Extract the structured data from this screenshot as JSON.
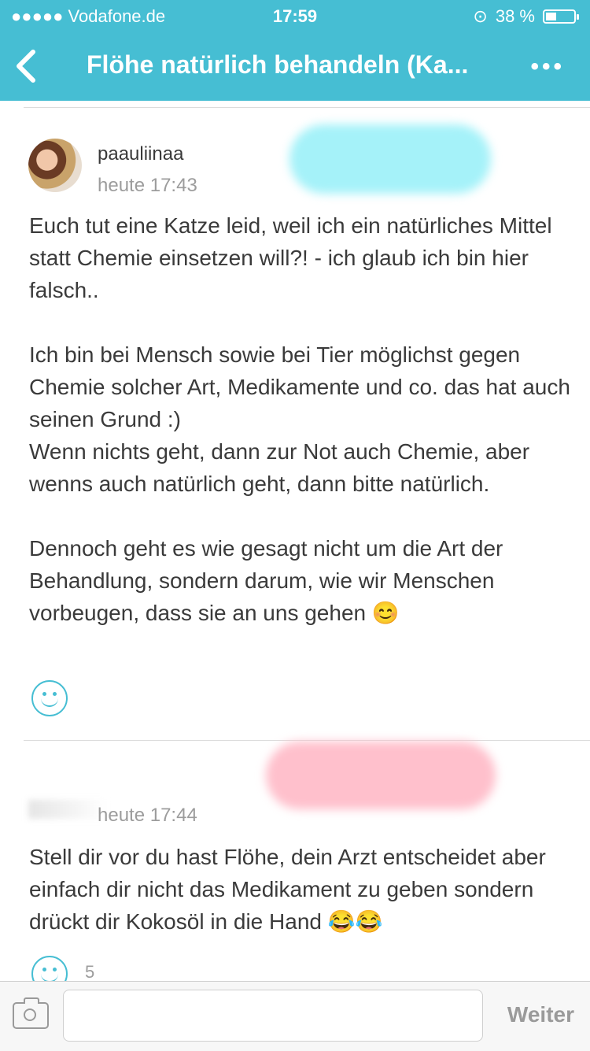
{
  "status_bar": {
    "carrier": "●●●●● Vodafone.de",
    "time": "17:59",
    "battery": "38 %",
    "battery_level": 0.38
  },
  "nav": {
    "title": "Flöhe natürlich behandeln (Ka...",
    "more_label": "•••"
  },
  "posts": [
    {
      "username": "paauliinaa",
      "time": "heute 17:43",
      "paragraphs": [
        "Euch tut eine Katze leid, weil ich ein natürliches Mittel statt Chemie einsetzen will?! - ich glaub ich bin hier falsch..",
        "Ich bin bei Mensch sowie bei Tier möglichst gegen Chemie solcher Art, Medikamente und co. das hat auch seinen Grund :)\nWenn nichts geht, dann zur Not auch Chemie, aber wenns auch natürlich geht, dann bitte natürlich.",
        "Dennoch geht es wie gesagt nicht um die Art der Behandlung, sondern darum, wie wir Menschen vorbeugen, dass sie an uns gehen"
      ],
      "emoji": "😊"
    },
    {
      "time": "heute 17:44",
      "text": "Stell dir vor du hast Flöhe, dein Arzt entscheidet aber einfach dir nicht das Medikament zu geben sondern drückt dir Kokosöl in die Hand",
      "emoji": "😂😂",
      "like_count": "5"
    }
  ],
  "composer": {
    "placeholder": "",
    "send_label": "Weiter"
  },
  "colors": {
    "accent": "#46bed3",
    "text": "#3a3a3a",
    "muted": "#9c9c9c"
  }
}
